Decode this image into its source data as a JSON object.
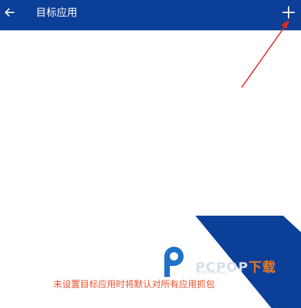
{
  "appbar": {
    "title": "目标应用",
    "back_icon": "arrow-left-icon",
    "add_icon": "plus-icon",
    "background": "#0b3f98"
  },
  "hint": {
    "text": "未设置目标应用时将默认对所有应用抓包",
    "color": "#e8502b"
  },
  "watermark": {
    "brand": "PCPOP",
    "suffix": "下载",
    "sub": "PCPOP Download"
  },
  "annotation": {
    "arrow_color": "#e0281f"
  }
}
